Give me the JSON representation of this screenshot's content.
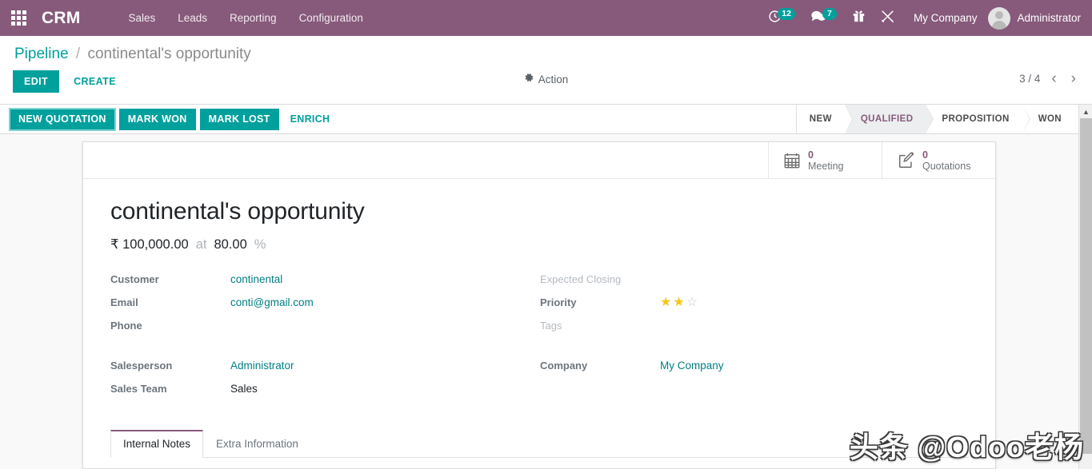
{
  "navbar": {
    "apps_icon": "apps-grid-icon",
    "brand": "CRM",
    "menu": [
      {
        "label": "Sales"
      },
      {
        "label": "Leads"
      },
      {
        "label": "Reporting"
      },
      {
        "label": "Configuration"
      }
    ],
    "sys_icons": [
      {
        "name": "activity-clock-icon",
        "badge": "12"
      },
      {
        "name": "messages-chat-icon",
        "badge": "7"
      },
      {
        "name": "gift-icon",
        "badge": ""
      },
      {
        "name": "tools-icon",
        "badge": ""
      }
    ],
    "company": "My Company",
    "user": "Administrator",
    "brand_color": "#875A7B",
    "badge_color": "#00A09D"
  },
  "breadcrumb": {
    "root": "Pipeline",
    "separator": "/",
    "current": "continental's opportunity"
  },
  "control_panel": {
    "edit_label": "EDIT",
    "create_label": "CREATE",
    "action_label": "Action",
    "gear_icon": "gear-icon",
    "pager": "3 / 4",
    "prev_icon": "chevron-left-icon",
    "next_icon": "chevron-right-icon"
  },
  "statusbar": {
    "buttons": [
      {
        "label": "NEW QUOTATION",
        "style": "primary",
        "focused": true
      },
      {
        "label": "MARK WON",
        "style": "primary",
        "focused": false
      },
      {
        "label": "MARK LOST",
        "style": "primary",
        "focused": false
      },
      {
        "label": "ENRICH",
        "style": "link",
        "focused": false
      }
    ],
    "stages": [
      {
        "label": "NEW",
        "active": false
      },
      {
        "label": "QUALIFIED",
        "active": true
      },
      {
        "label": "PROPOSITION",
        "active": false
      },
      {
        "label": "WON",
        "active": false
      }
    ],
    "active_stage_color": "#875A7B"
  },
  "scrollbar": {
    "up_arrow": "▲"
  },
  "button_boxes": [
    {
      "icon": "calendar-icon",
      "value": "0",
      "label": "Meeting"
    },
    {
      "icon": "quotation-edit-icon",
      "value": "0",
      "label": "Quotations"
    }
  ],
  "record": {
    "title": "continental's opportunity",
    "currency_symbol": "₹",
    "expected_revenue": "100,000.00",
    "at_word": "at",
    "probability": "80.00",
    "percent_symbol": "%",
    "left_fields": [
      {
        "label": "Customer",
        "value": "continental",
        "link": true,
        "empty_label": false
      },
      {
        "label": "Email",
        "value": "conti@gmail.com",
        "link": true,
        "empty_label": false
      },
      {
        "label": "Phone",
        "value": "",
        "link": false,
        "empty_label": false
      },
      {
        "label": "Salesperson",
        "value": "Administrator",
        "link": true,
        "empty_label": false
      },
      {
        "label": "Sales Team",
        "value": "Sales",
        "link": false,
        "empty_label": false
      }
    ],
    "right_fields": [
      {
        "label": "Expected Closing",
        "value": "",
        "link": false,
        "empty_label": true
      },
      {
        "label": "Priority",
        "value": "",
        "link": false,
        "empty_label": false,
        "stars": {
          "filled": 2,
          "total": 3
        }
      },
      {
        "label": "Tags",
        "value": "",
        "link": false,
        "empty_label": true
      },
      {
        "label": "Company",
        "value": "My Company",
        "link": true,
        "empty_label": false
      }
    ]
  },
  "tabs": [
    {
      "label": "Internal Notes",
      "active": true
    },
    {
      "label": "Extra Information",
      "active": false
    }
  ],
  "watermark": {
    "text": "头条 @Odoo老杨"
  }
}
